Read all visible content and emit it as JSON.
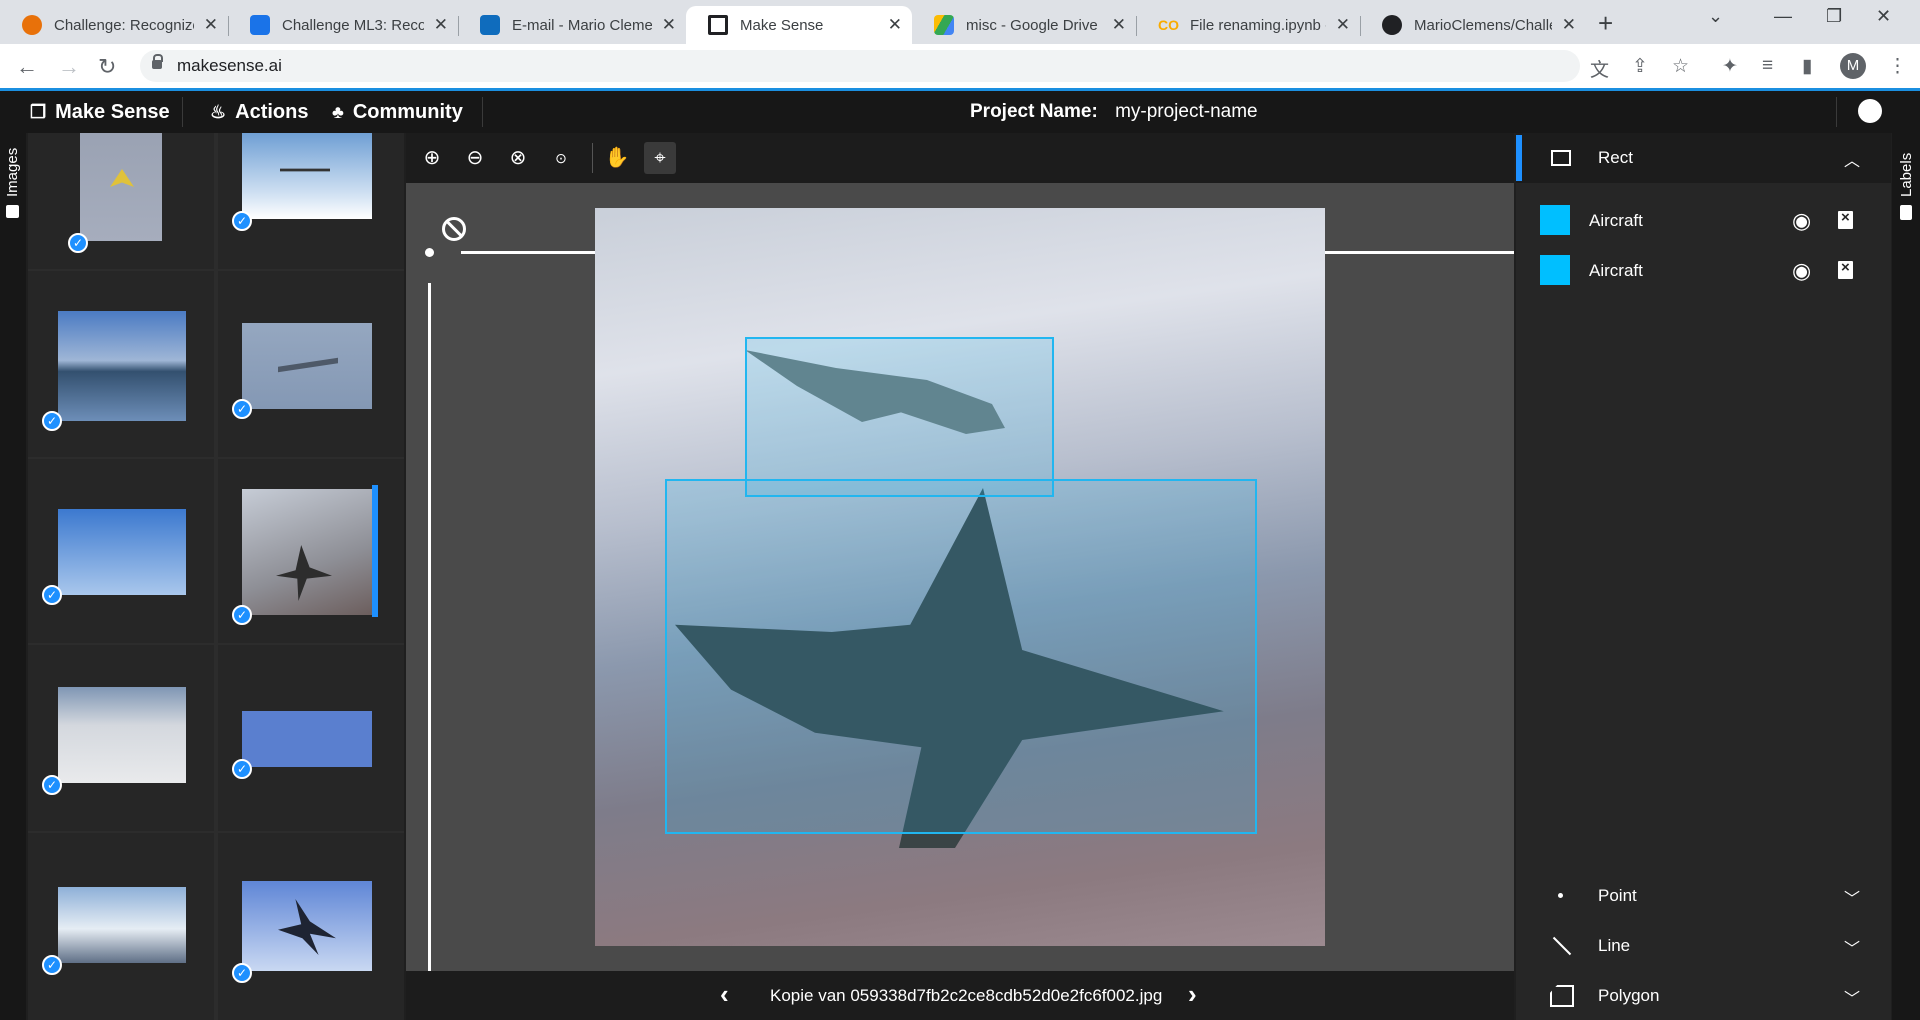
{
  "browser": {
    "tabs": [
      {
        "title": "Challenge: Recognize",
        "icon_color": "#e8710a"
      },
      {
        "title": "Challenge ML3: Recog",
        "icon_color": "#1a73e8"
      },
      {
        "title": "E-mail - Mario Clemen",
        "icon_color": "#0f6cbd"
      },
      {
        "title": "Make Sense",
        "icon_color": "#202124"
      },
      {
        "title": "misc - Google Drive",
        "icon_color": "#34a853"
      },
      {
        "title": "File renaming.ipynb -",
        "icon_color": "#f9ab00"
      },
      {
        "title": "MarioClemens/Challe",
        "icon_color": "#202124"
      }
    ],
    "active_tab": 3,
    "url": "makesense.ai",
    "profile_initial": "M"
  },
  "app": {
    "brand": "Make Sense",
    "nav": {
      "actions": "Actions",
      "community": "Community"
    },
    "project_label": "Project Name:",
    "project_name": "my-project-name",
    "left_tab_label": "Images",
    "right_tab_label": "Labels"
  },
  "editor": {
    "filename": "Kopie van 059338d7fb2c2ce8cdb52d0e2fc6f002.jpg"
  },
  "right_panel": {
    "active_tool": "Rect",
    "labels": [
      {
        "name": "Aircraft",
        "color": "#00bfff"
      },
      {
        "name": "Aircraft",
        "color": "#00bfff"
      }
    ],
    "other_tools": [
      "Point",
      "Line",
      "Polygon"
    ]
  },
  "accent_color": "#1e90ff",
  "bbox_color": "#21b6f0"
}
